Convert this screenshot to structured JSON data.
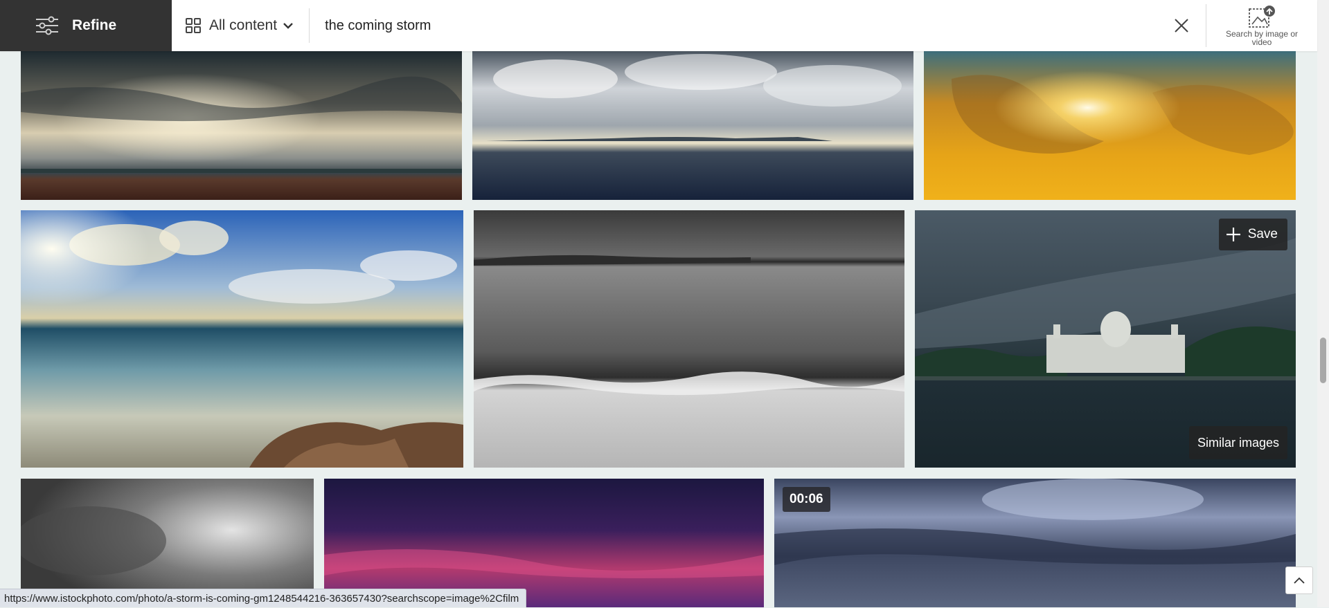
{
  "header": {
    "refine_label": "Refine",
    "content_type_label": "All content",
    "search_value": "the coming storm",
    "visual_search_label": "Search by image or video"
  },
  "tiles": {
    "save_label": "Save",
    "similar_label": "Similar images",
    "video_duration": "00:06"
  },
  "status_bar": {
    "url": "https://www.istockphoto.com/photo/a-storm-is-coming-gm1248544216-363657430?searchscope=image%2Cfilm"
  },
  "colors": {
    "refine_bg": "#333333",
    "page_bg": "#eaf0ef",
    "overlay_button_bg": "#232323"
  },
  "icons": {
    "refine": "sliders-icon",
    "content_type": "grid-icon",
    "dropdown": "chevron-down-icon",
    "clear": "close-icon",
    "visual_search": "image-upload-icon",
    "save": "plus-icon",
    "back_to_top": "chevron-up-icon"
  }
}
